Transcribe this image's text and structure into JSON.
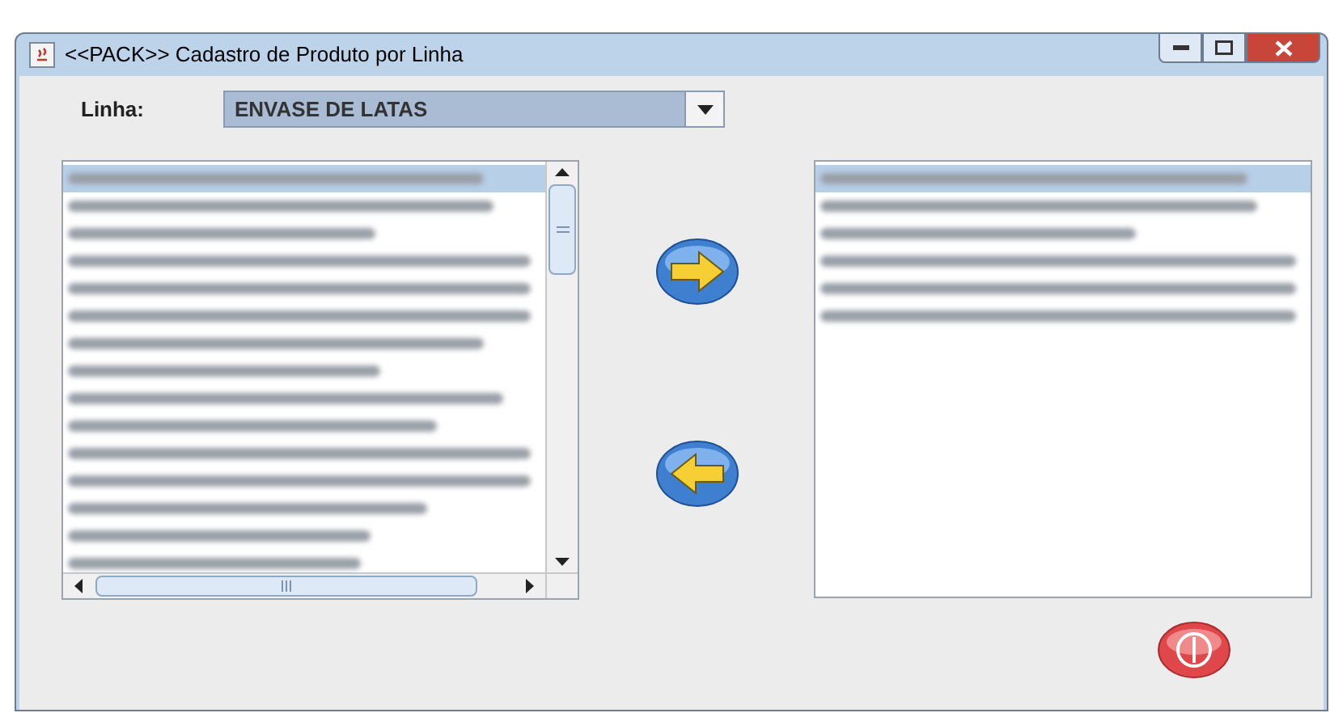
{
  "window": {
    "title": "<<PACK>> Cadastro de Produto por Linha"
  },
  "linha": {
    "label": "Linha:",
    "value": "ENVASE DE LATAS"
  },
  "available_list": {
    "items": [
      {
        "kind": "redacted",
        "selected": true
      },
      {
        "kind": "redacted",
        "selected": false
      },
      {
        "kind": "redacted",
        "selected": false
      },
      {
        "kind": "redacted",
        "selected": false
      },
      {
        "kind": "redacted",
        "selected": false
      },
      {
        "kind": "redacted",
        "selected": false
      },
      {
        "kind": "redacted",
        "selected": false
      },
      {
        "kind": "redacted",
        "selected": false
      },
      {
        "kind": "redacted",
        "selected": false
      },
      {
        "kind": "redacted",
        "selected": false
      },
      {
        "kind": "redacted",
        "selected": false
      },
      {
        "kind": "redacted",
        "selected": false
      },
      {
        "kind": "redacted",
        "selected": false
      },
      {
        "kind": "redacted",
        "selected": false
      },
      {
        "kind": "redacted",
        "selected": false
      }
    ]
  },
  "assigned_list": {
    "items": [
      {
        "kind": "redacted",
        "selected": true
      },
      {
        "kind": "redacted",
        "selected": false
      },
      {
        "kind": "redacted",
        "selected": false
      },
      {
        "kind": "redacted",
        "selected": false
      },
      {
        "kind": "redacted",
        "selected": false
      },
      {
        "kind": "redacted",
        "selected": false
      }
    ]
  }
}
